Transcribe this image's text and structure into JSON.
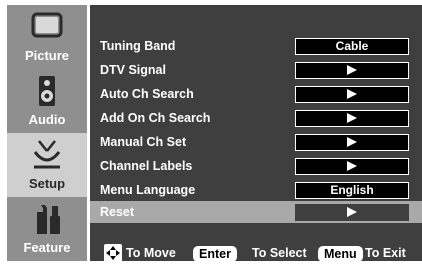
{
  "sidebar": {
    "items": [
      {
        "label": "Picture",
        "icon": "monitor-icon",
        "active": false
      },
      {
        "label": "Audio",
        "icon": "speaker-icon",
        "active": false
      },
      {
        "label": "Setup",
        "icon": "antenna-tv-icon",
        "active": true
      },
      {
        "label": "Feature",
        "icon": "tools-icon",
        "active": false
      }
    ]
  },
  "menu": {
    "rows": [
      {
        "label": "Tuning Band",
        "value": "Cable",
        "type": "text"
      },
      {
        "label": "DTV Signal",
        "value": "",
        "type": "arrow"
      },
      {
        "label": "Auto Ch Search",
        "value": "",
        "type": "arrow"
      },
      {
        "label": "Add On Ch Search",
        "value": "",
        "type": "arrow"
      },
      {
        "label": "Manual Ch Set",
        "value": "",
        "type": "arrow"
      },
      {
        "label": "Channel Labels",
        "value": "",
        "type": "arrow"
      },
      {
        "label": "Menu Language",
        "value": "English",
        "type": "text"
      },
      {
        "label": "Reset",
        "value": "",
        "type": "arrow",
        "selected": true
      }
    ]
  },
  "footer": {
    "move_label": "To Move",
    "enter_key": "Enter",
    "select_label": "To Select",
    "menu_key": "Menu",
    "exit_label": "To Exit",
    "dpad_icon": "dpad-icon"
  },
  "colors": {
    "panel": "#3f3f3f",
    "sidebar": "#8f8f8f",
    "sidebar_active": "#cfcfcf",
    "selected_row": "#a9a9a9"
  }
}
